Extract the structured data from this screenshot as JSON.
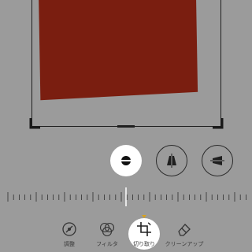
{
  "toolbar": {
    "adjust_label": "調整",
    "filter_label": "フィルタ",
    "crop_label": "切り取り",
    "cleanup_label": "クリーンアップ"
  },
  "perspective": {
    "buttons": [
      {
        "name": "straighten",
        "icon": "straighten-icon",
        "active": true
      },
      {
        "name": "vertical",
        "icon": "vertical-perspective-icon",
        "active": false
      },
      {
        "name": "horizontal",
        "icon": "horizontal-perspective-icon",
        "active": false
      }
    ]
  },
  "colors": {
    "background": "#9b9b9b",
    "photo": "#7a1e10",
    "active": "#ffffff",
    "accent": "#d7a21f"
  }
}
